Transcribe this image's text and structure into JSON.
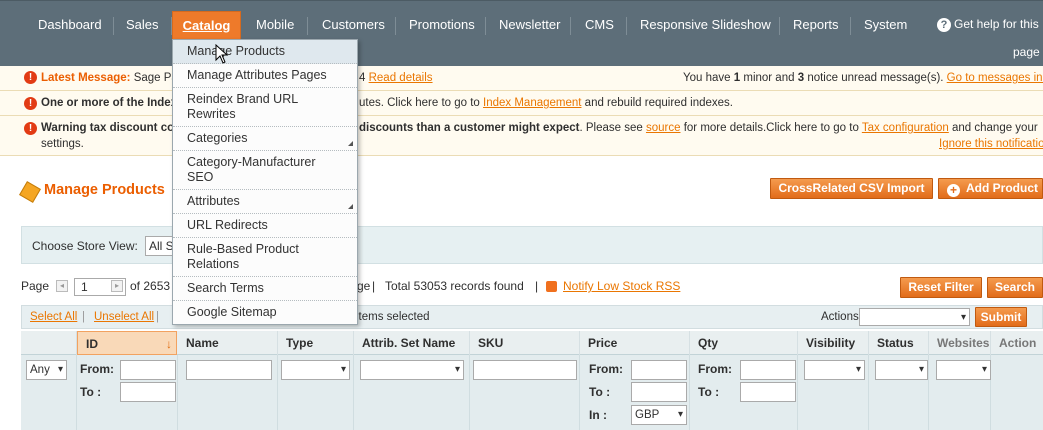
{
  "nav": {
    "items": [
      "Dashboard",
      "Sales",
      "Catalog",
      "Mobile",
      "Customers",
      "Promotions",
      "Newsletter",
      "CMS",
      "Responsive Slideshow",
      "Reports",
      "System"
    ],
    "help_line1": "Get help for this",
    "help_line2": "page"
  },
  "catalog_menu": {
    "items": [
      "Manage Products",
      "Manage Attributes Pages",
      "Reindex Brand URL Rewrites",
      "Categories",
      "Category-Manufacturer SEO",
      "Attributes",
      "URL Redirects",
      "Rule-Based Product Relations",
      "Search Terms",
      "Google Sitemap"
    ]
  },
  "messages": {
    "latest_label": "Latest Message:",
    "latest_text": "Sage Pa",
    "latest_fragment": "4",
    "read_details": "Read details",
    "unread_prefix": "You have",
    "unread_minor": "1",
    "unread_mid": "minor and",
    "unread_notice": "3",
    "unread_suffix": "notice unread message(s).",
    "go_to_inbox": "Go to messages inbox",
    "index_bold": "One or more of the Index",
    "index_tail": "utes. Click here to go to",
    "index_link": "Index Management",
    "index_end": "and rebuild required indexes.",
    "warning_bold": "Warning tax discount co",
    "warning_bold2": "discounts than a customer might expect",
    "warning_mid": ". Please see",
    "warning_source": "source",
    "warning_mid2": "for more details.Click here to go to",
    "warning_tax_link": "Tax configuration",
    "warning_end": "and change your",
    "warning_line2": "settings.",
    "ignore_link": "Ignore this notification"
  },
  "header": {
    "title": "Manage Products",
    "crossrelated_button": "CrossRelated CSV Import",
    "add_button": "Add Product"
  },
  "store": {
    "label": "Choose Store View:",
    "value": "All S"
  },
  "pager": {
    "page_label": "Page",
    "page_value": "1",
    "of_pages": "of 2653",
    "per_page_tail": "ge",
    "records": "Total 53053 records found",
    "rss_link": "Notify Low Stock RSS",
    "reset_button": "Reset Filter",
    "search_button": "Search"
  },
  "mass": {
    "select_all": "Select All",
    "unselect_all": "Unselect All",
    "items_selected": "items selected",
    "actions_label": "Actions",
    "submit": "Submit"
  },
  "grid": {
    "columns": [
      "ID",
      "Name",
      "Type",
      "Attrib. Set Name",
      "SKU",
      "Price",
      "Qty",
      "Visibility",
      "Status",
      "Websites",
      "Action"
    ],
    "id_filter_any": "Any",
    "from_label": "From:",
    "to_label": "To :",
    "in_label": "In :",
    "currency": "GBP"
  }
}
